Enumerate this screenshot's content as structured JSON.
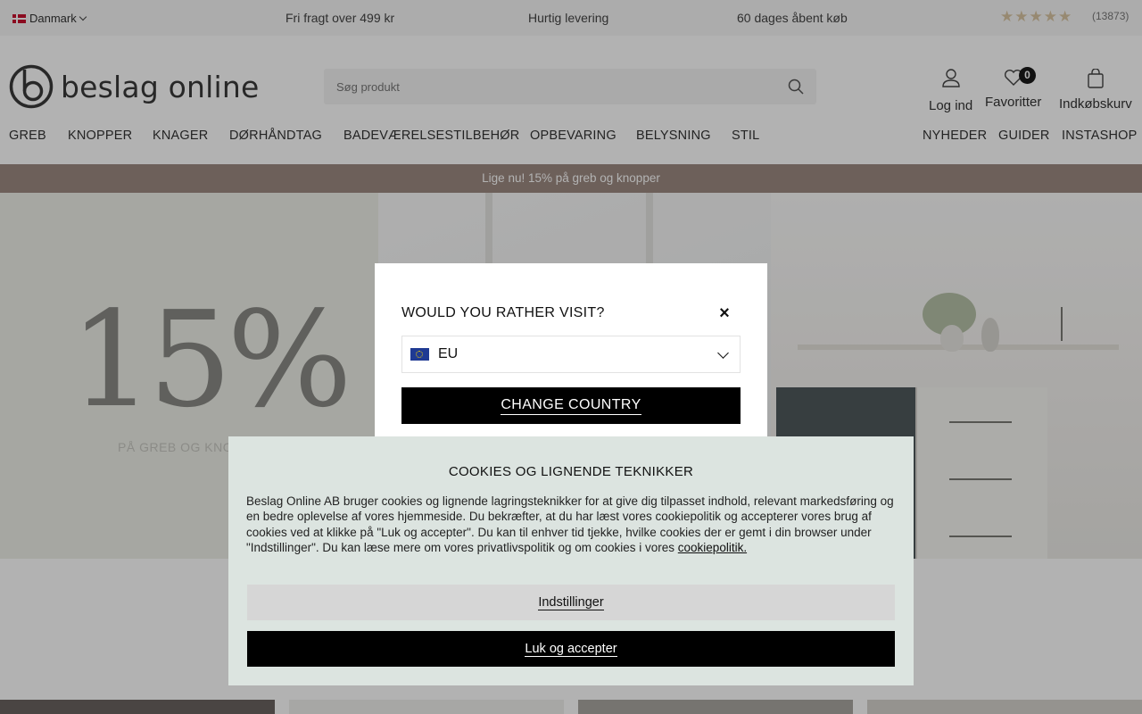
{
  "topbar": {
    "country": "Danmark",
    "usps": [
      "Fri fragt over 499 kr",
      "Hurtig levering",
      "60 dages åbent køb"
    ],
    "rating_stars": 5,
    "rating_count": "(13873)"
  },
  "header": {
    "logo_text": "beslag online",
    "search_placeholder": "Søg produkt",
    "login_label": "Log ind",
    "favorites_label": "Favoritter",
    "favorites_count": "0",
    "cart_label": "Indkøbskurv"
  },
  "nav": {
    "main": [
      "GREB",
      "KNOPPER",
      "KNAGER",
      "DØRHÅNDTAG",
      "BADEVÆRELSESTILBEHØR",
      "OPBEVARING",
      "BELYSNING",
      "STIL"
    ],
    "secondary": [
      "NYHEDER",
      "GUIDER",
      "INSTASHOP"
    ]
  },
  "promo": {
    "text": "Lige nu! 15% på greb og knopper"
  },
  "hero": {
    "percent": "15%",
    "subtitle": "PÅ GREB OG KNOPPER"
  },
  "country_modal": {
    "title": "WOULD YOU RATHER VISIT?",
    "close": "×",
    "selected_country": "EU",
    "button": "CHANGE COUNTRY"
  },
  "cookie_banner": {
    "title": "COOKIES OG LIGNENDE TEKNIKKER",
    "text": "Beslag Online AB bruger cookies og lignende lagringsteknikker for at give dig tilpasset indhold, relevant markedsføring og en bedre oplevelse af vores hjemmeside. Du bekræfter, at du har læst vores cookiepolitik og accepterer vores brug af cookies ved at klikke på \"Luk og accepter\". Du kan til enhver tid tjekke, hvilke cookies der er gemt i din browser under \"Indstillinger\". Du kan læse mere om vores privatlivspolitik og om cookies i vores",
    "link": "cookiepolitik.",
    "settings_button": "Indstillinger",
    "accept_button": "Luk og accepter"
  },
  "colors": {
    "promo_bg": "#9c8a82",
    "star": "#d8c4a3",
    "cookie_bg": "#dce4e0",
    "primary_button": "#000000"
  }
}
